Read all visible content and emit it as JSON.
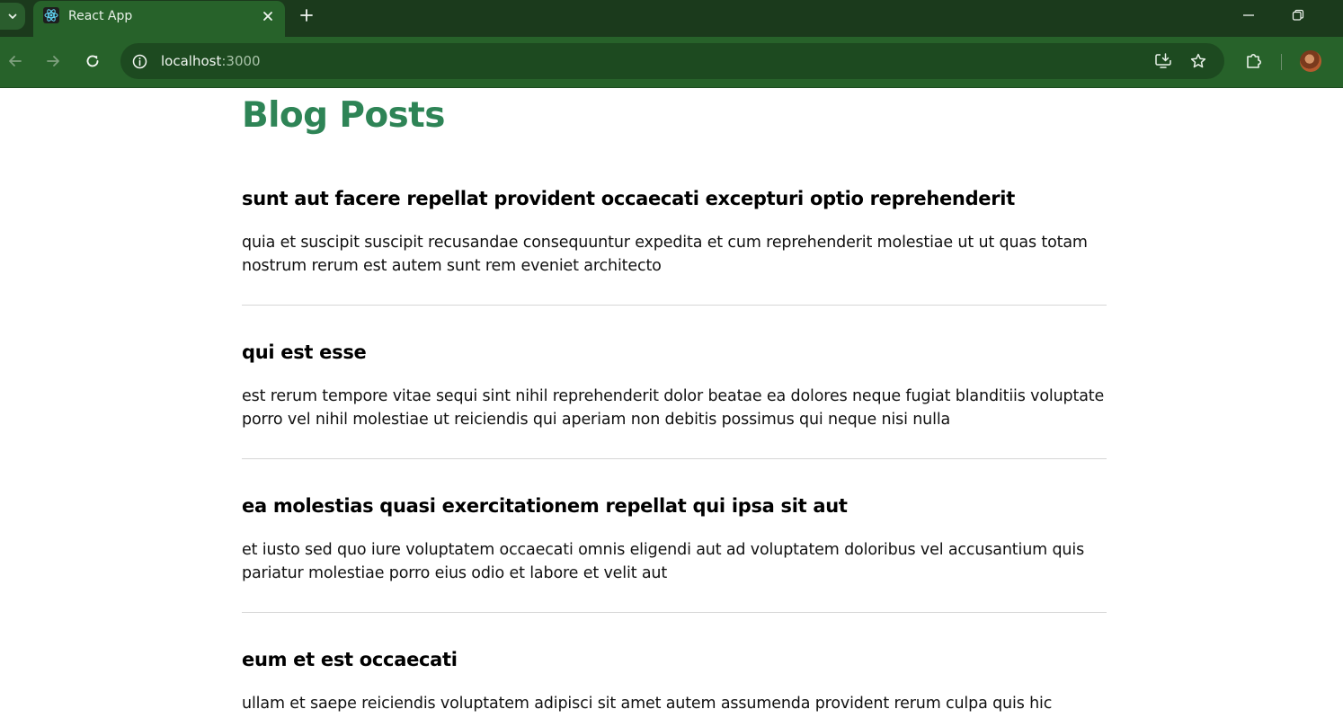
{
  "browser": {
    "tab": {
      "title": "React App",
      "favicon": "react-logo-icon"
    },
    "omnibox": {
      "host": "localhost",
      "port": ":3000"
    },
    "icons": {
      "tab_search": "chevron-down-icon",
      "close_tab": "close-icon",
      "new_tab": "plus-icon",
      "minimize": "minimize-icon",
      "restore": "restore-icon",
      "back": "back-arrow-icon",
      "forward": "forward-arrow-icon",
      "reload": "reload-icon",
      "site_info": "info-icon",
      "install_app": "install-icon",
      "bookmark": "star-icon",
      "extensions": "puzzle-icon",
      "profile": "avatar"
    },
    "colors": {
      "frame": "#1b3a1c",
      "toolbar": "#27622a",
      "omnibox": "#1d4a20"
    }
  },
  "page": {
    "title": "Blog Posts",
    "title_color": "#2e8456",
    "posts": [
      {
        "title": "sunt aut facere repellat provident occaecati excepturi optio reprehenderit",
        "body": "quia et suscipit suscipit recusandae consequuntur expedita et cum reprehenderit molestiae ut ut quas totam nostrum rerum est autem sunt rem eveniet architecto"
      },
      {
        "title": "qui est esse",
        "body": "est rerum tempore vitae sequi sint nihil reprehenderit dolor beatae ea dolores neque fugiat blanditiis voluptate porro vel nihil molestiae ut reiciendis qui aperiam non debitis possimus qui neque nisi nulla"
      },
      {
        "title": "ea molestias quasi exercitationem repellat qui ipsa sit aut",
        "body": "et iusto sed quo iure voluptatem occaecati omnis eligendi aut ad voluptatem doloribus vel accusantium quis pariatur molestiae porro eius odio et labore et velit aut"
      },
      {
        "title": "eum et est occaecati",
        "body": "ullam et saepe reiciendis voluptatem adipisci sit amet autem assumenda provident rerum culpa quis hic"
      }
    ]
  }
}
